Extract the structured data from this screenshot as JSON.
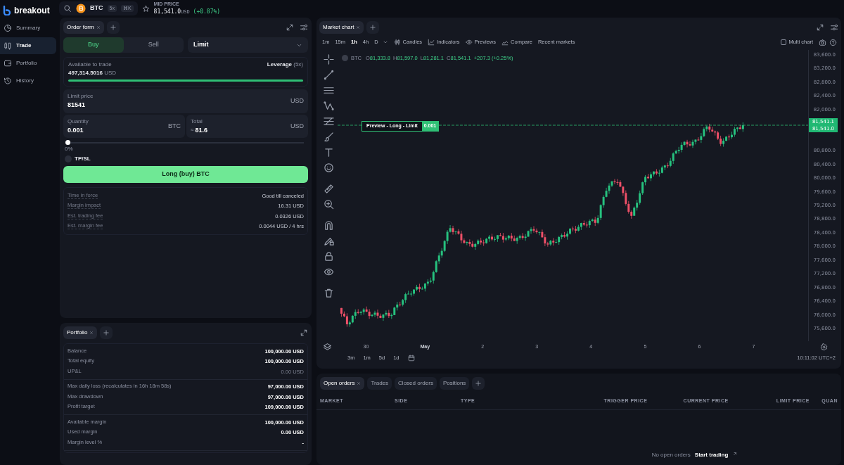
{
  "brand": {
    "name": "breakout"
  },
  "nav": [
    {
      "label": "Summary",
      "selected": false
    },
    {
      "label": "Trade",
      "selected": true
    },
    {
      "label": "Portfolio",
      "selected": false
    },
    {
      "label": "History",
      "selected": false
    }
  ],
  "market": {
    "symbol": "BTC",
    "leverage": "5x",
    "shortcut": "⌘K",
    "mid_price_label": "MID PRICE",
    "mid_price": "81,541.0",
    "currency": "USD",
    "change": "(+0.87%)"
  },
  "order_form": {
    "tab": "Order form",
    "sides": [
      {
        "label": "Buy",
        "selected": true
      },
      {
        "label": "Sell",
        "selected": false
      }
    ],
    "order_type": "Limit",
    "available_label": "Available to trade",
    "available": "497,314.5016",
    "available_unit": "USD",
    "leverage_label": "Leverage",
    "leverage": "(5x)",
    "level": 1,
    "limit_price": {
      "label": "Limit price",
      "value": "81541",
      "unit": "USD"
    },
    "quantity": {
      "label": "Quantity",
      "value": "0.001",
      "unit": "BTC"
    },
    "total": {
      "label": "Total",
      "prefix": "≈",
      "value": "81.6",
      "unit": "USD"
    },
    "size_slider": {
      "level": 0,
      "reading": "0%"
    },
    "tpsl": {
      "label": "TP/SL",
      "checked": false
    },
    "submit": "Long (buy) BTC",
    "details": [
      {
        "label": "Time in force",
        "value": "Good till canceled"
      },
      {
        "label": "Margin impact",
        "value": "16.31 USD"
      },
      {
        "label": "Est. trading fee",
        "value": "0.0326 USD"
      },
      {
        "label": "Est. margin fee",
        "value": "0.0044 USD / 4 hrs"
      }
    ]
  },
  "portfolio": {
    "tab": "Portfolio",
    "groups": [
      [
        {
          "label": "Balance",
          "value": "100,000.00 USD",
          "muted": false
        },
        {
          "label": "Total equity",
          "value": "100,000.00 USD",
          "muted": false
        },
        {
          "label": "UP&L",
          "value": "0.00 USD",
          "muted": true
        }
      ],
      [
        {
          "label": "Max daily loss (recalculates in 16h 18m 58s)",
          "value": "97,000.00 USD",
          "muted": false
        },
        {
          "label": "Max drawdown",
          "value": "97,000.00 USD",
          "muted": false
        },
        {
          "label": "Profit target",
          "value": "109,000.00 USD",
          "muted": false
        }
      ],
      [
        {
          "label": "Available margin",
          "value": "100,000.00 USD",
          "muted": false
        },
        {
          "label": "Used margin",
          "value": "0.00 USD",
          "muted": false
        },
        {
          "label": "Margin level %",
          "value": "-",
          "muted": false
        }
      ]
    ]
  },
  "chart": {
    "tab": "Market chart",
    "intervals": [
      {
        "label": "1m",
        "selected": false
      },
      {
        "label": "15m",
        "selected": false
      },
      {
        "label": "1h",
        "selected": true
      },
      {
        "label": "4h",
        "selected": false
      },
      {
        "label": "D",
        "selected": false
      }
    ],
    "tools": [
      "Candles",
      "Indicators",
      "Previews",
      "Compare",
      "Recent markets"
    ],
    "multi_chart": {
      "label": "Multi chart",
      "checked": false
    },
    "legend": {
      "symbol": "BTC",
      "fields": [
        {
          "key": "O",
          "value": "81,333.8"
        },
        {
          "key": "H",
          "value": "81,597.0"
        },
        {
          "key": "L",
          "value": "81,281.1"
        },
        {
          "key": "C",
          "value": "81,541.1"
        }
      ],
      "change": "+207.3 (+0.25%)"
    },
    "preview": {
      "label": "Preview - Long - Limit",
      "quantity": "0.001"
    },
    "price_tags": [
      "81,541.1",
      "81,541.0"
    ],
    "y_ticks": [
      "83,600.0",
      "83,200.0",
      "82,800.0",
      "82,400.0",
      "82,000.0",
      "80,800.0",
      "80,400.0",
      "80,000.0",
      "79,600.0",
      "79,200.0",
      "78,800.0",
      "78,400.0",
      "78,000.0",
      "77,600.0",
      "77,200.0",
      "76,800.0",
      "76,400.0",
      "76,000.0",
      "75,600.0"
    ],
    "x_ticks": [
      {
        "label": "30",
        "major": false
      },
      {
        "label": "May",
        "major": true
      },
      {
        "label": "2",
        "major": false
      },
      {
        "label": "3",
        "major": false
      },
      {
        "label": "4",
        "major": false
      },
      {
        "label": "5",
        "major": false
      },
      {
        "label": "6",
        "major": false
      },
      {
        "label": "7",
        "major": false
      }
    ],
    "ranges": [
      "3m",
      "1m",
      "5d",
      "1d"
    ],
    "clock": "10:11:02 UTC+2"
  },
  "orders": {
    "tabs": [
      {
        "label": "Open orders",
        "selected": true
      },
      {
        "label": "Trades",
        "selected": false
      },
      {
        "label": "Closed orders",
        "selected": false
      },
      {
        "label": "Positions",
        "selected": false
      }
    ],
    "columns": [
      "MARKET",
      "SIDE",
      "TYPE",
      "TRIGGER PRICE",
      "CURRENT PRICE",
      "LIMIT PRICE",
      "QUAN"
    ],
    "empty": "No open orders",
    "link": "Start trading"
  }
}
